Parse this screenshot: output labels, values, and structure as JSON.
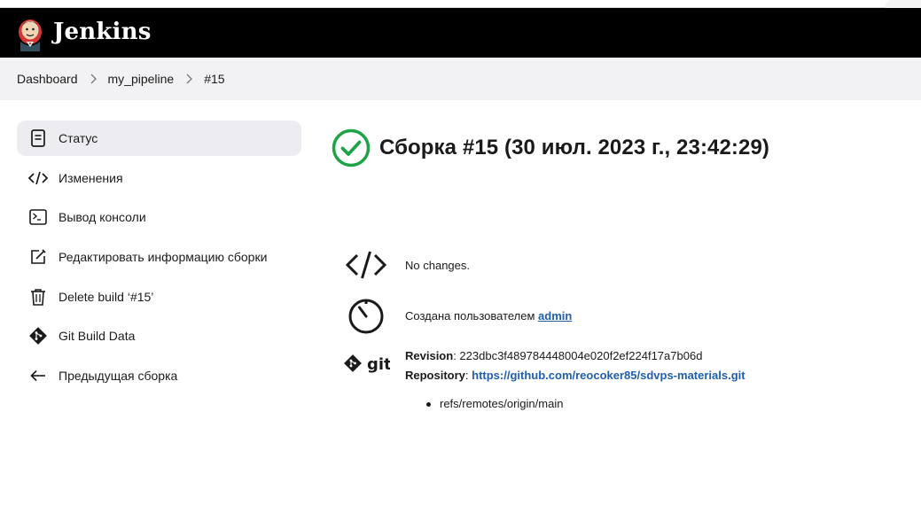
{
  "header": {
    "brand": "Jenkins",
    "logo_icon": "jenkins-butler-icon",
    "background": "#000000"
  },
  "breadcrumb": {
    "items": [
      "Dashboard",
      "my_pipeline",
      "#15"
    ]
  },
  "sidebar": {
    "items": [
      {
        "label": "Статус",
        "icon": "document-icon",
        "active": true
      },
      {
        "label": "Изменения",
        "icon": "code-icon"
      },
      {
        "label": "Вывод консоли",
        "icon": "terminal-icon"
      },
      {
        "label": "Редактировать информацию сборки",
        "icon": "edit-icon"
      },
      {
        "label": "Delete build ‘#15’",
        "icon": "trash-icon"
      },
      {
        "label": "Git Build Data",
        "icon": "git-icon"
      },
      {
        "label": "Предыдущая сборка",
        "icon": "arrow-left-icon"
      }
    ]
  },
  "build": {
    "title": "Сборка #15 (30 июл. 2023 г., 23:42:29)",
    "status": "success",
    "status_color": "#1ea446"
  },
  "changes": {
    "text": "No changes."
  },
  "started_by": {
    "prefix": "Создана пользователем ",
    "user": "admin"
  },
  "git": {
    "revision_label": "Revision",
    "revision_value": "223dbc3f489784448004e020f2ef224f17a7b06d",
    "repository_label": "Repository",
    "repository_url": "https://github.com/reocoker85/sdvps-materials.git",
    "branches": [
      "refs/remotes/origin/main"
    ],
    "logo_text": "git"
  },
  "colors": {
    "link": "#1f5fad",
    "active_item_bg": "#ececf1",
    "breadcrumb_bg": "#f2f2f4"
  }
}
